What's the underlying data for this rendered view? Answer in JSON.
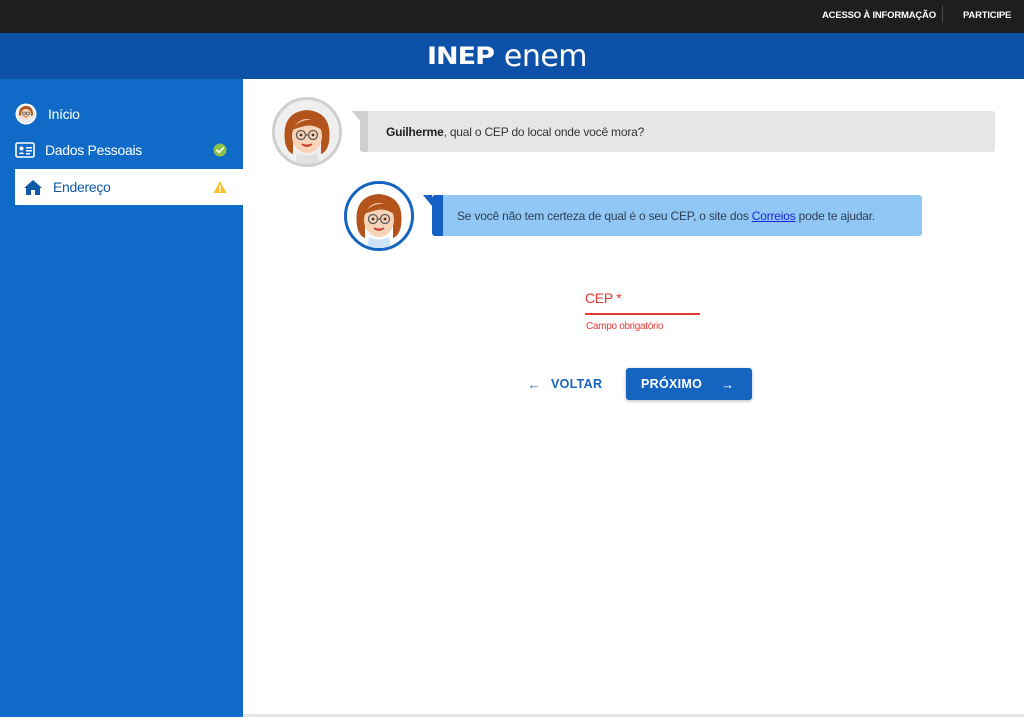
{
  "topbar": {
    "acesso_label": "ACESSO À INFORMAÇÃO",
    "participe_label": "PARTICIPE"
  },
  "header": {
    "logo_inep": "INEP",
    "logo_enem": "enem"
  },
  "sidebar": {
    "items": [
      {
        "label": "Início",
        "icon": "avatar-icon",
        "status": ""
      },
      {
        "label": "Dados Pessoais",
        "icon": "id-card-icon",
        "status": "check-icon"
      },
      {
        "label": "Endereço",
        "icon": "home-icon",
        "status": "warning-icon"
      }
    ]
  },
  "chat": {
    "question_name": "Guilherme",
    "question_text": ", qual o CEP do local onde você mora?",
    "tip_before": "Se você não tem certeza de qual é o seu CEP, o site dos ",
    "tip_link": "Correios",
    "tip_after": " pode te ajudar."
  },
  "form": {
    "cep_label": "CEP *",
    "cep_error": "Campo obrigatório"
  },
  "buttons": {
    "back_label": "VOLTAR",
    "next_label": "PRÓXIMO"
  },
  "colors": {
    "header_blue": "#0d52a8",
    "sidebar_blue": "#0f6bc7",
    "primary": "#1565c0",
    "error": "#e53935",
    "success": "#8bc34a",
    "warning": "#fbc02d",
    "tip_bubble": "#90c7f4"
  }
}
